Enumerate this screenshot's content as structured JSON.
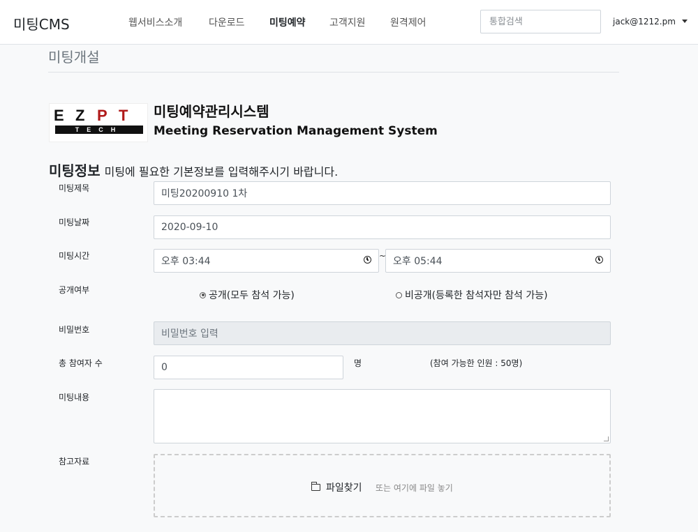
{
  "navbar": {
    "brand": "미팅CMS",
    "items": [
      {
        "label": "웹서비스소개",
        "active": false
      },
      {
        "label": "다운로드",
        "active": false
      },
      {
        "label": "미팅예약",
        "active": true
      },
      {
        "label": "고객지원",
        "active": false
      },
      {
        "label": "원격제어",
        "active": false
      }
    ],
    "search_placeholder": "통합검색",
    "user": "jack@1212.pm"
  },
  "page": {
    "title": "미팅개설",
    "logo": {
      "letters": [
        "E",
        "Z",
        "P",
        "T"
      ],
      "sub": "TECH"
    },
    "system_title_ko": "미팅예약관리시스템",
    "system_title_en": "Meeting Reservation Management System",
    "section_title": "미팅정보",
    "section_desc": "미팅에 필요한 기본정보를 입력해주시기 바랍니다."
  },
  "form": {
    "title_label": "미팅제목",
    "title_value": "미팅20200910 1차",
    "date_label": "미팅날짜",
    "date_value": "2020-09-10",
    "time_label": "미팅시간",
    "time_start": "오후 03:44",
    "time_separator": "~",
    "time_end": "오후 05:44",
    "public_label": "공개여부",
    "public_options": [
      {
        "label": "공개(모두 참석 가능)",
        "checked": true
      },
      {
        "label": "비공개(등록한 참석자만 참석 가능)",
        "checked": false
      }
    ],
    "password_label": "비밀번호",
    "password_placeholder": "비밀번호 입력",
    "participants_label": "총 참여자 수",
    "participants_value": "0",
    "participants_unit": "명",
    "participants_capacity": "(참여 가능한 인원 : 50명)",
    "content_label": "미팅내용",
    "content_value": "",
    "attachment_label": "참고자료",
    "file_button": "파일찾기",
    "drop_hint": "또는 여기에 파일 놓기"
  }
}
